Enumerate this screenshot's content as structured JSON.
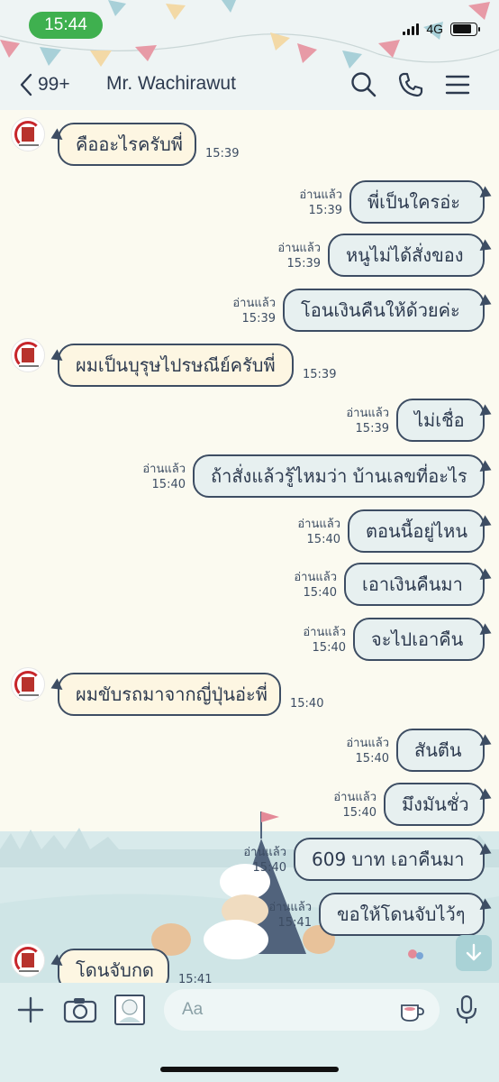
{
  "status": {
    "time": "15:44",
    "network": "4G"
  },
  "nav": {
    "back_count": "99+",
    "title": "Mr. Wachirawut"
  },
  "messages": [
    {
      "dir": "in",
      "text": "คืออะไรครับพี่",
      "time": "15:39",
      "avatar": true
    },
    {
      "dir": "out",
      "text": "พี่เป็นใครอ่ะ",
      "read": "อ่านแล้ว",
      "time": "15:39"
    },
    {
      "dir": "out",
      "text": "หนูไม่ได้สั่งของ",
      "read": "อ่านแล้ว",
      "time": "15:39"
    },
    {
      "dir": "out",
      "text": "โอนเงินคืนให้ด้วยค่ะ",
      "read": "อ่านแล้ว",
      "time": "15:39"
    },
    {
      "dir": "in",
      "text": "ผมเป็นบุรุษไปรษณีย์ครับพี่",
      "time": "15:39",
      "avatar": true
    },
    {
      "dir": "out",
      "text": "ไม่เชื่อ",
      "read": "อ่านแล้ว",
      "time": "15:39"
    },
    {
      "dir": "out",
      "text": "ถ้าสั่งแล้วรู้ไหมว่า บ้านเลขที่อะไร",
      "read": "อ่านแล้ว",
      "time": "15:40"
    },
    {
      "dir": "out",
      "text": "ตอนนี้อยู่ไหน",
      "read": "อ่านแล้ว",
      "time": "15:40"
    },
    {
      "dir": "out",
      "text": "เอาเงินคืนมา",
      "read": "อ่านแล้ว",
      "time": "15:40"
    },
    {
      "dir": "out",
      "text": "จะไปเอาคืน",
      "read": "อ่านแล้ว",
      "time": "15:40"
    },
    {
      "dir": "in",
      "text": "ผมขับรถมาจากญี่ปุ่นอ่ะพี่",
      "time": "15:40",
      "avatar": true
    },
    {
      "dir": "out",
      "text": "สันตีน",
      "read": "อ่านแล้ว",
      "time": "15:40"
    },
    {
      "dir": "out",
      "text": "มึงมันชั่ว",
      "read": "อ่านแล้ว",
      "time": "15:40"
    },
    {
      "dir": "out",
      "text": "609 บาท เอาคืนมา",
      "read": "อ่านแล้ว",
      "time": "15:40"
    },
    {
      "dir": "out",
      "text": "ขอให้โดนจับไว้ๆ",
      "read": "อ่านแล้ว",
      "time": "15:41"
    },
    {
      "dir": "in",
      "text": "โดนจับกด",
      "time": "15:41",
      "avatar": true
    }
  ],
  "composer": {
    "placeholder": "Aa"
  },
  "colors": {
    "bubble_border": "#3d4d63",
    "incoming_bubble": "#fdf6e2",
    "outgoing_bubble": "#e7f0f0",
    "status_pill": "#3fb04f",
    "composer_bg": "#deeeee"
  },
  "icons": [
    "chevron-left-icon",
    "search-icon",
    "phone-icon",
    "menu-icon",
    "plus-icon",
    "camera-icon",
    "photo-icon",
    "sticker-icon",
    "microphone-icon",
    "arrow-down-icon"
  ]
}
